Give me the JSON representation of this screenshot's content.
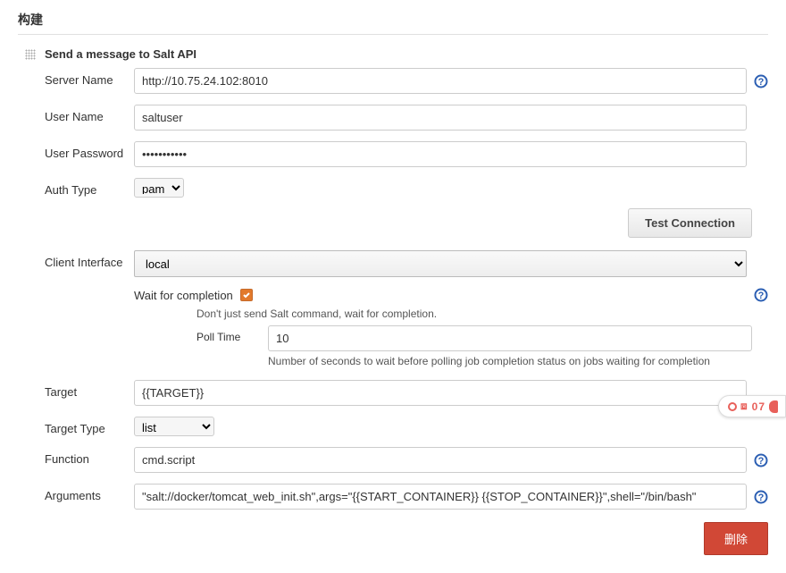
{
  "sectionTitle": "构建",
  "stepTitle": "Send a message to Salt API",
  "labels": {
    "serverName": "Server Name",
    "userName": "User Name",
    "userPassword": "User Password",
    "authType": "Auth Type",
    "clientInterface": "Client Interface",
    "waitForCompletion": "Wait for completion",
    "pollTime": "Poll Time",
    "target": "Target",
    "targetType": "Target Type",
    "function": "Function",
    "arguments": "Arguments"
  },
  "values": {
    "serverName": "http://10.75.24.102:8010",
    "userName": "saltuser",
    "userPassword": "•••••••••••",
    "authType": "pam",
    "clientInterface": "local",
    "pollTime": "10",
    "target": "{{TARGET}}",
    "targetType": "list",
    "function": "cmd.script",
    "arguments": "\"salt://docker/tomcat_web_init.sh\",args=\"{{START_CONTAINER}} {{STOP_CONTAINER}}\",shell=\"/bin/bash\""
  },
  "help": {
    "waitHint": "Don't just send Salt command, wait for completion.",
    "pollHint": "Number of seconds to wait before polling job completion status on jobs waiting for completion"
  },
  "buttons": {
    "testConnection": "Test Connection",
    "delete": "删除"
  },
  "floatingWidget": {
    "text": "07"
  }
}
